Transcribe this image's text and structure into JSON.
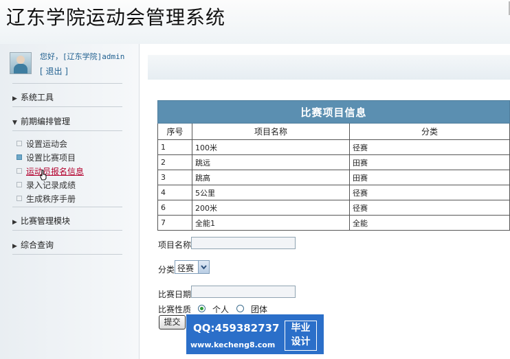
{
  "app": {
    "title": "辽东学院运动会管理系统"
  },
  "user": {
    "greeting": "您好，[辽东学院]admin",
    "logout": "[ 退出 ]"
  },
  "sidebar": {
    "groups": [
      {
        "label": "系统工具",
        "expanded": false
      },
      {
        "label": "前期编排管理",
        "expanded": true,
        "items": [
          "设置运动会",
          "设置比赛项目",
          "运动员报名信息",
          "录入记录成绩",
          "生成秩序手册"
        ]
      },
      {
        "label": "比赛管理模块",
        "expanded": false
      },
      {
        "label": "综合查询",
        "expanded": false
      }
    ],
    "selected_item": "设置比赛项目",
    "hovered_item": "运动员报名信息"
  },
  "table": {
    "caption": "比赛项目信息",
    "headers": [
      "序号",
      "项目名称",
      "分类"
    ],
    "rows": [
      [
        "1",
        "100米",
        "径赛"
      ],
      [
        "2",
        "跳远",
        "田赛"
      ],
      [
        "3",
        "跳高",
        "田赛"
      ],
      [
        "4",
        "5公里",
        "径赛"
      ],
      [
        "6",
        "200米",
        "径赛"
      ],
      [
        "7",
        "全能1",
        "全能"
      ]
    ]
  },
  "form": {
    "name_label": "项目名称",
    "name_value": "",
    "type_label": "分类",
    "type_selected": "径赛",
    "date_label": "比赛日期",
    "date_value": "",
    "nature_label": "比赛性质",
    "nature_options": [
      "个人",
      "团体"
    ],
    "nature_selected": "个人",
    "submit_label": "提交"
  },
  "watermark": {
    "qq": "QQ:459382737",
    "url": "www.kecheng8.com",
    "badge_line1": "毕业",
    "badge_line2": "设计"
  },
  "colors": {
    "table_caption_bg": "#5b8fb1",
    "hover_link": "#b3002d",
    "watermark_bg": "#2b6fc9"
  }
}
